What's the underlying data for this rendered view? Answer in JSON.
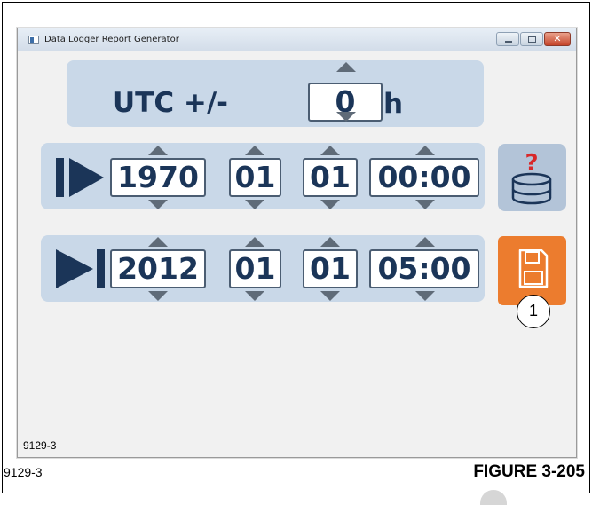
{
  "window": {
    "title": "Data Logger Report Generator",
    "controls": {
      "minimize": "minimize-icon",
      "maximize": "maximize-icon",
      "close": "close-icon"
    },
    "corner_code": "9129-3"
  },
  "utc": {
    "label": "UTC +/-",
    "offset": "0",
    "unit": "h"
  },
  "start": {
    "icon": "play-start-icon",
    "year": "1970",
    "month": "01",
    "day": "01",
    "time": "00:00"
  },
  "end": {
    "icon": "skip-to-end-icon",
    "year": "2012",
    "month": "01",
    "day": "01",
    "time": "05:00"
  },
  "buttons": {
    "database_query": {
      "icon": "database-question-icon",
      "badge": "?"
    },
    "save": {
      "icon": "floppy-disk-icon"
    }
  },
  "callout": "1",
  "figure": {
    "code": "9129-3",
    "label": "FIGURE 3-205"
  },
  "colors": {
    "panel": "#c9d8e8",
    "text": "#1b3558",
    "save_accent": "#ec7c2e",
    "db_button": "#b3c4d8",
    "question_mark": "#d8282a"
  }
}
